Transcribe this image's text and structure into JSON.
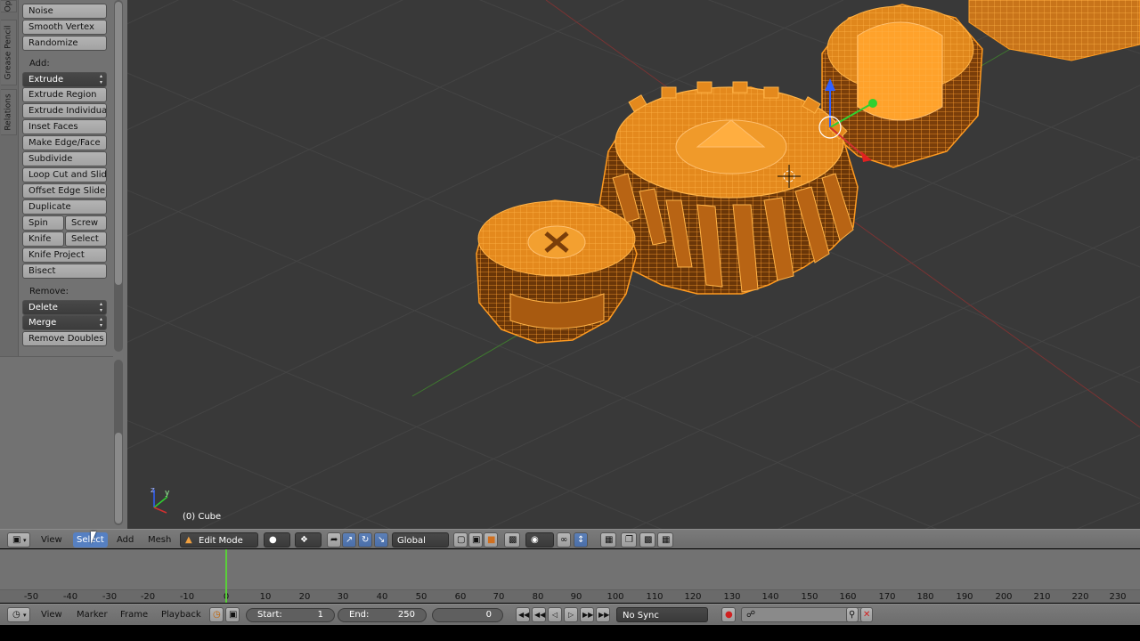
{
  "toolshelf": {
    "tabs": [
      "Op",
      "Grease Pencil",
      "Relations"
    ],
    "buttons_top": [
      "Noise",
      "Smooth Vertex",
      "Randomize"
    ],
    "add_label": "Add:",
    "add_dropdown": "Extrude",
    "add_buttons": [
      "Extrude Region",
      "Extrude Individual",
      "Inset Faces",
      "Make Edge/Face",
      "Subdivide",
      "Loop Cut and Slide",
      "Offset Edge Slide",
      "Duplicate"
    ],
    "spin": "Spin",
    "screw": "Screw",
    "knife": "Knife",
    "select": "Select",
    "knife_project": "Knife Project",
    "bisect": "Bisect",
    "remove_label": "Remove:",
    "delete_dropdown": "Delete",
    "merge_dropdown": "Merge",
    "remove_doubles": "Remove Doubles"
  },
  "viewport": {
    "object_label": "(0) Cube",
    "axes": {
      "z": "z",
      "y": "y"
    }
  },
  "view_header": {
    "menus": [
      "View",
      "Select",
      "Add",
      "Mesh"
    ],
    "mode": "Edit Mode",
    "orientation": "Global"
  },
  "timeline": {
    "ticks": [
      "-50",
      "-40",
      "-30",
      "-20",
      "-10",
      "0",
      "10",
      "20",
      "30",
      "40",
      "50",
      "60",
      "70",
      "80",
      "90",
      "100",
      "110",
      "120",
      "130",
      "140",
      "150",
      "160",
      "170",
      "180",
      "190",
      "200",
      "210",
      "220",
      "230"
    ],
    "current_frame_marker": "0"
  },
  "timeline_header": {
    "menus": [
      "View",
      "Marker",
      "Frame",
      "Playback"
    ],
    "start_label": "Start:",
    "start_value": "1",
    "end_label": "End:",
    "end_value": "250",
    "current_frame": "0",
    "sync": "No Sync"
  },
  "colors": {
    "accent": "#5680c2",
    "selection": "#ff9a1f",
    "background": "#393939",
    "playhead": "#5acf3a"
  }
}
